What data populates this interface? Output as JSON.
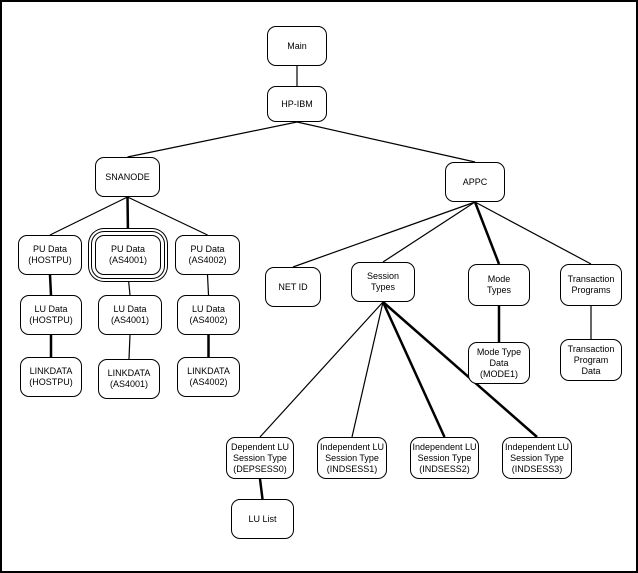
{
  "nodes": [
    {
      "id": "main",
      "label": "Main"
    },
    {
      "id": "hpibm",
      "label": "HP-IBM"
    },
    {
      "id": "snanode",
      "label": "SNANODE"
    },
    {
      "id": "appc",
      "label": "APPC"
    },
    {
      "id": "pu_hostpu",
      "label": "PU Data\n(HOSTPU)"
    },
    {
      "id": "pu_as4001",
      "label": "PU Data\n(AS4001)",
      "selected": true
    },
    {
      "id": "pu_as4002",
      "label": "PU Data\n(AS4002)"
    },
    {
      "id": "lu_hostpu",
      "label": "LU Data\n(HOSTPU)"
    },
    {
      "id": "lu_as4001",
      "label": "LU Data\n(AS4001)"
    },
    {
      "id": "lu_as4002",
      "label": "LU Data\n(AS4002)"
    },
    {
      "id": "link_hostpu",
      "label": "LINKDATA\n(HOSTPU)"
    },
    {
      "id": "link_as4001",
      "label": "LINKDATA\n(AS4001)"
    },
    {
      "id": "link_as4002",
      "label": "LINKDATA\n(AS4002)"
    },
    {
      "id": "netid",
      "label": "NET ID"
    },
    {
      "id": "session",
      "label": "Session\nTypes"
    },
    {
      "id": "mode",
      "label": "Mode\nTypes"
    },
    {
      "id": "tp",
      "label": "Transaction\nPrograms"
    },
    {
      "id": "modedata",
      "label": "Mode Type\nData\n(MODE1)"
    },
    {
      "id": "tpdata",
      "label": "Transaction\nProgram\nData"
    },
    {
      "id": "dep",
      "label": "Dependent LU\nSession Type\n(DEPSESS0)"
    },
    {
      "id": "ind1",
      "label": "Independent LU\nSession Type\n(INDSESS1)"
    },
    {
      "id": "ind2",
      "label": "Independent LU\nSession Type\n(INDSESS2)"
    },
    {
      "id": "ind3",
      "label": "Independent LU\nSession Type\n(INDSESS3)"
    },
    {
      "id": "lulist",
      "label": "LU List"
    }
  ],
  "edges": [
    [
      "main",
      "hpibm"
    ],
    [
      "hpibm",
      "snanode"
    ],
    [
      "hpibm",
      "appc"
    ],
    [
      "snanode",
      "pu_hostpu"
    ],
    [
      "snanode",
      "pu_as4001"
    ],
    [
      "snanode",
      "pu_as4002"
    ],
    [
      "pu_hostpu",
      "lu_hostpu"
    ],
    [
      "pu_as4001",
      "lu_as4001"
    ],
    [
      "pu_as4002",
      "lu_as4002"
    ],
    [
      "lu_hostpu",
      "link_hostpu"
    ],
    [
      "lu_as4001",
      "link_as4001"
    ],
    [
      "lu_as4002",
      "link_as4002"
    ],
    [
      "appc",
      "netid"
    ],
    [
      "appc",
      "session"
    ],
    [
      "appc",
      "mode"
    ],
    [
      "appc",
      "tp"
    ],
    [
      "mode",
      "modedata"
    ],
    [
      "tp",
      "tpdata"
    ],
    [
      "session",
      "dep"
    ],
    [
      "session",
      "ind1"
    ],
    [
      "session",
      "ind2"
    ],
    [
      "session",
      "ind3"
    ],
    [
      "dep",
      "lulist"
    ]
  ]
}
